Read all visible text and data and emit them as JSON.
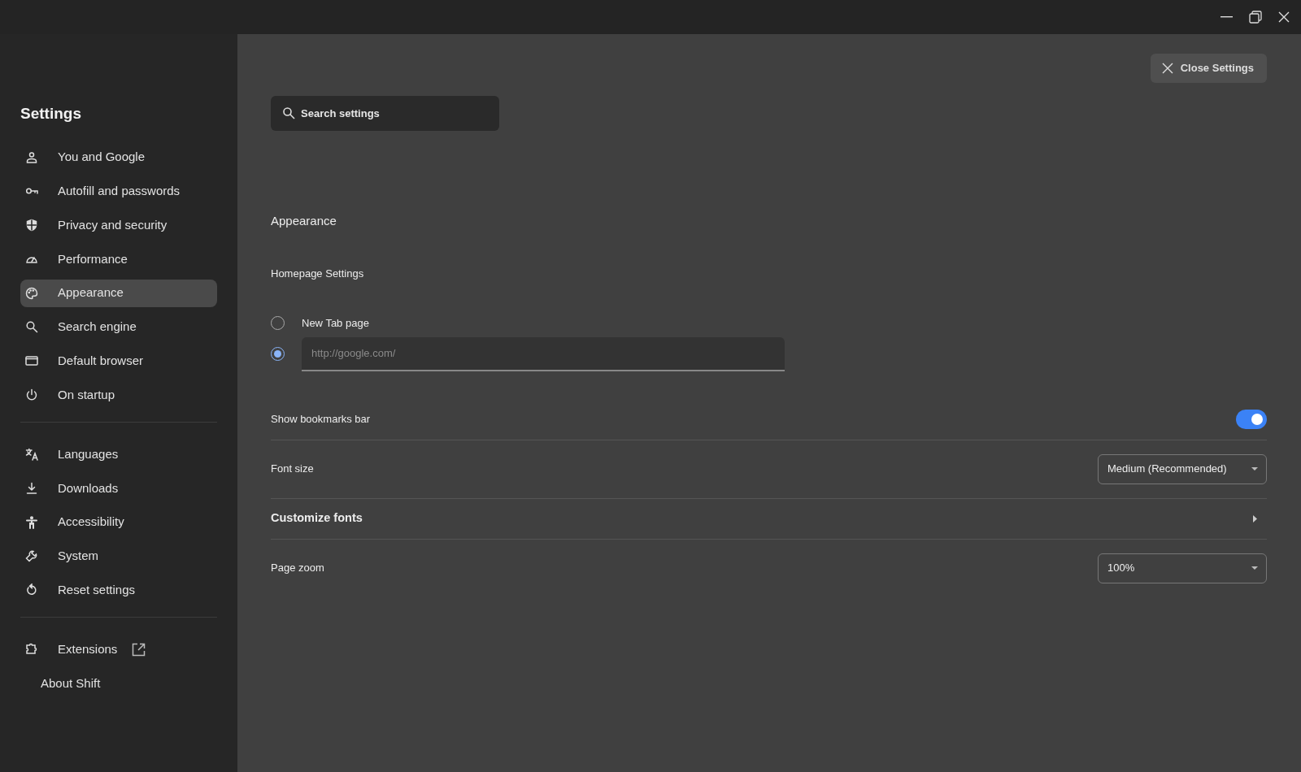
{
  "sidebar": {
    "title": "Settings",
    "groups": [
      [
        {
          "label": "You and Google",
          "selected": false
        },
        {
          "label": "Autofill and passwords",
          "selected": false
        },
        {
          "label": "Privacy and security",
          "selected": false
        },
        {
          "label": "Performance",
          "selected": false
        },
        {
          "label": "Appearance",
          "selected": true
        },
        {
          "label": "Search engine",
          "selected": false
        },
        {
          "label": "Default browser",
          "selected": false
        },
        {
          "label": "On startup",
          "selected": false
        }
      ],
      [
        {
          "label": "Languages",
          "selected": false
        },
        {
          "label": "Downloads",
          "selected": false
        },
        {
          "label": "Accessibility",
          "selected": false
        },
        {
          "label": "System",
          "selected": false
        },
        {
          "label": "Reset settings",
          "selected": false
        }
      ],
      [
        {
          "kind": "external",
          "label": "Extensions",
          "selected": false
        },
        {
          "kind": "plain",
          "label": "About Shift",
          "selected": false
        }
      ]
    ]
  },
  "close_button": {
    "label": "Close Settings"
  },
  "search": {
    "placeholder": "Search settings"
  },
  "section_title": "Appearance",
  "homepage": {
    "title": "Homepage Settings",
    "options": [
      {
        "kind": "label",
        "label": "New Tab page",
        "selected": false
      },
      {
        "kind": "url",
        "placeholder": "http://google.com/",
        "selected": true
      }
    ]
  },
  "rows": [
    {
      "kind": "toggle",
      "label": "Show bookmarks bar",
      "on": true
    },
    {
      "kind": "select",
      "label": "Font size",
      "value": "Medium (Recommended)"
    },
    {
      "kind": "expand",
      "label": "Customize fonts"
    },
    {
      "kind": "select",
      "label": "Page zoom",
      "value": "100%"
    }
  ]
}
